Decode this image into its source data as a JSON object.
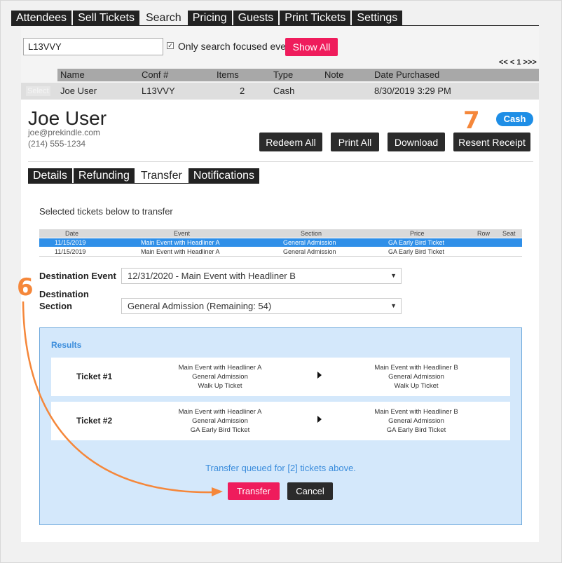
{
  "nav": {
    "tabs": [
      "Attendees",
      "Sell Tickets",
      "Search",
      "Pricing",
      "Guests",
      "Print Tickets",
      "Settings"
    ],
    "active": "Search"
  },
  "search": {
    "value": "L13VVY",
    "focus_label": "Only search focused event.",
    "show_all": "Show All",
    "pager": "<< < 1 >>>"
  },
  "results_table": {
    "columns": [
      "Name",
      "Conf #",
      "Items",
      "Type",
      "Note",
      "Date Purchased"
    ],
    "row": {
      "select": "Select",
      "name": "Joe User",
      "conf": "L13VVY",
      "items": "2",
      "type": "Cash",
      "note": "",
      "date": "8/30/2019 3:29 PM"
    }
  },
  "customer": {
    "name": "Joe User",
    "email": "joe@prekindle.com",
    "phone": "(214) 555-1234",
    "badge": "Cash",
    "step_number": "7"
  },
  "actions": {
    "redeem_all": "Redeem All",
    "print_all": "Print All",
    "download": "Download",
    "resent_receipt": "Resent Receipt"
  },
  "subtabs": {
    "items": [
      "Details",
      "Refunding",
      "Transfer",
      "Notifications"
    ],
    "active": "Transfer"
  },
  "transfer": {
    "intro": "Selected tickets below to transfer",
    "ticket_table": {
      "columns": [
        "Date",
        "Event",
        "Section",
        "Price",
        "Row",
        "Seat"
      ],
      "rows": [
        {
          "date": "11/15/2019",
          "event": "Main Event with Headliner A",
          "section": "General Admission",
          "price": "GA Early Bird Ticket",
          "row": "",
          "seat": ""
        },
        {
          "date": "11/15/2019",
          "event": "Main Event with Headliner A",
          "section": "General Admission",
          "price": "GA Early Bird Ticket",
          "row": "",
          "seat": ""
        }
      ]
    },
    "dest_event_label": "Destination Event",
    "dest_event_value": "12/31/2020 - Main Event with Headliner B",
    "dest_section_label_1": "Destination",
    "dest_section_label_2": "Section",
    "dest_section_value": "General Admission (Remaining: 54)",
    "step_number": "6"
  },
  "results": {
    "title": "Results",
    "tickets": [
      {
        "label": "Ticket #1",
        "from": [
          "Main Event with Headliner A",
          "General Admission",
          "Walk Up Ticket"
        ],
        "to": [
          "Main Event with Headliner B",
          "General Admission",
          "Walk Up Ticket"
        ]
      },
      {
        "label": "Ticket #2",
        "from": [
          "Main Event with Headliner A",
          "General Admission",
          "GA Early Bird Ticket"
        ],
        "to": [
          "Main Event with Headliner B",
          "General Admission",
          "GA Early Bird Ticket"
        ]
      }
    ],
    "queued": "Transfer queued for [2] tickets above.",
    "transfer_btn": "Transfer",
    "cancel_btn": "Cancel"
  },
  "colors": {
    "accent_pink": "#ef1c5c",
    "dark": "#2b2b2b",
    "blue": "#2f8fe8",
    "annotation_orange": "#f5873a"
  }
}
